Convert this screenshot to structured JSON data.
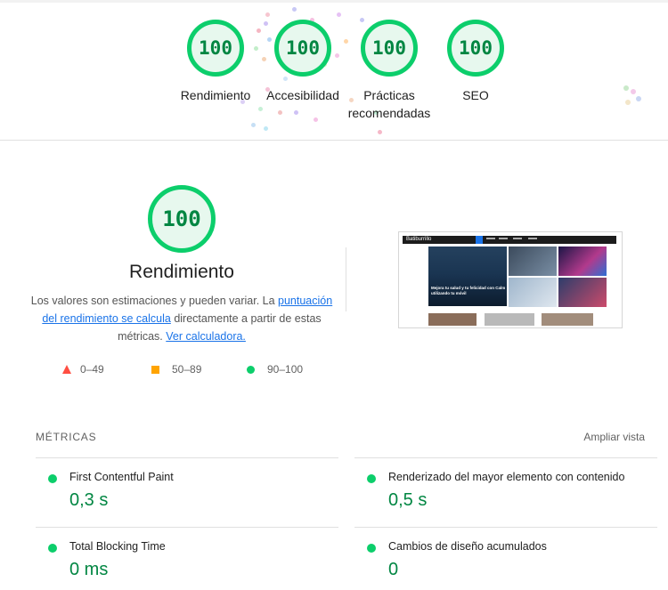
{
  "summary": {
    "gauges": [
      {
        "score": "100",
        "label_lines": [
          "Rendimiento"
        ]
      },
      {
        "score": "100",
        "label_lines": [
          "Accesibilidad"
        ]
      },
      {
        "score": "100",
        "label_lines": [
          "Prácticas",
          "recomendadas"
        ]
      },
      {
        "score": "100",
        "label_lines": [
          "SEO"
        ]
      }
    ]
  },
  "performance": {
    "score": "100",
    "title": "Rendimiento",
    "description_part1": "Los valores son estimaciones y pueden variar. La ",
    "link1": "puntuación del rendimiento se calcula",
    "description_part2": " directamente a partir de estas métricas. ",
    "link2": "Ver calculadora.",
    "legend": [
      {
        "range": "0–49",
        "shape": "triangle",
        "color": "#ff4e42"
      },
      {
        "range": "50–89",
        "shape": "square",
        "color": "#ffa400"
      },
      {
        "range": "90–100",
        "shape": "circle",
        "color": "#0cce6b"
      }
    ]
  },
  "screenshot": {
    "site_logo": "Batiburrillo",
    "hero_caption": "Mejora tu salud y tu felicidad con Calm utilizando tu móvil"
  },
  "metrics": {
    "header": "MÉTRICAS",
    "expand_label": "Ampliar vista",
    "items": [
      {
        "title": "First Contentful Paint",
        "value": "0,3 s",
        "status": "good"
      },
      {
        "title": "Renderizado del mayor elemento con contenido",
        "value": "0,5 s",
        "status": "good"
      },
      {
        "title": "Total Blocking Time",
        "value": "0 ms",
        "status": "good"
      },
      {
        "title": "Cambios de diseño acumulados",
        "value": "0",
        "status": "good"
      }
    ]
  },
  "colors": {
    "pass": "#0cce6b",
    "pass_text": "#018642",
    "average": "#ffa400",
    "fail": "#ff4e42",
    "link": "#1a73e8"
  }
}
